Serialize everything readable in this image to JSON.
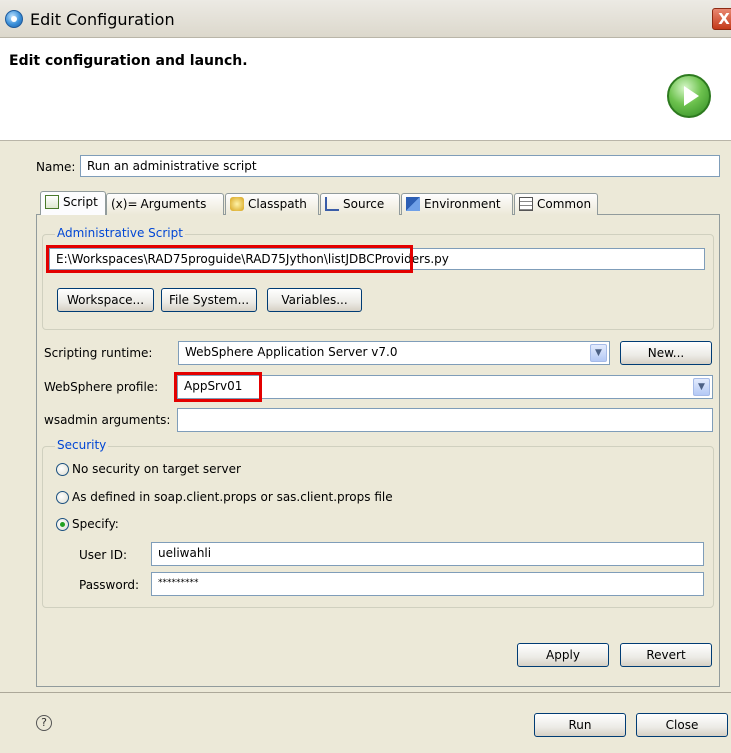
{
  "window": {
    "title": "Edit Configuration",
    "close_glyph": "X"
  },
  "header": {
    "title": "Edit configuration and launch."
  },
  "config": {
    "name_label": "Name:",
    "name_value": "Run an administrative script"
  },
  "tabs": [
    {
      "label": "Script",
      "icon": "script-icon",
      "active": true
    },
    {
      "label": "Arguments",
      "prefix": "(x)=",
      "icon": "arguments-icon"
    },
    {
      "label": "Classpath",
      "icon": "classpath-icon"
    },
    {
      "label": "Source",
      "icon": "source-icon"
    },
    {
      "label": "Environment",
      "icon": "environment-icon"
    },
    {
      "label": "Common",
      "icon": "common-icon"
    }
  ],
  "admin_script": {
    "group_title": "Administrative Script",
    "path": "E:\\Workspaces\\RAD75proguide\\RAD75Jython\\listJDBCProviders.py",
    "buttons": {
      "workspace": "Workspace...",
      "file_system": "File System...",
      "variables": "Variables..."
    }
  },
  "runtime": {
    "label": "Scripting runtime:",
    "value": "WebSphere Application Server v7.0",
    "new_button": "New..."
  },
  "profile": {
    "label": "WebSphere profile:",
    "value": "AppSrv01"
  },
  "wsadmin": {
    "label": "wsadmin arguments:",
    "value": ""
  },
  "security": {
    "group_title": "Security",
    "options": [
      {
        "label": "No security on target server",
        "checked": false
      },
      {
        "label": "As defined in soap.client.props or sas.client.props file",
        "checked": false
      },
      {
        "label": "Specify:",
        "checked": true
      }
    ],
    "user_id_label": "User ID:",
    "user_id": "ueliwahli",
    "password_label": "Password:",
    "password": "*********"
  },
  "actions": {
    "apply": "Apply",
    "revert": "Revert"
  },
  "footer": {
    "help_glyph": "?",
    "run": "Run",
    "close": "Close"
  },
  "colors": {
    "accent": "#0046d5",
    "highlight_box": "#e30000",
    "panel": "#ece9d8"
  }
}
